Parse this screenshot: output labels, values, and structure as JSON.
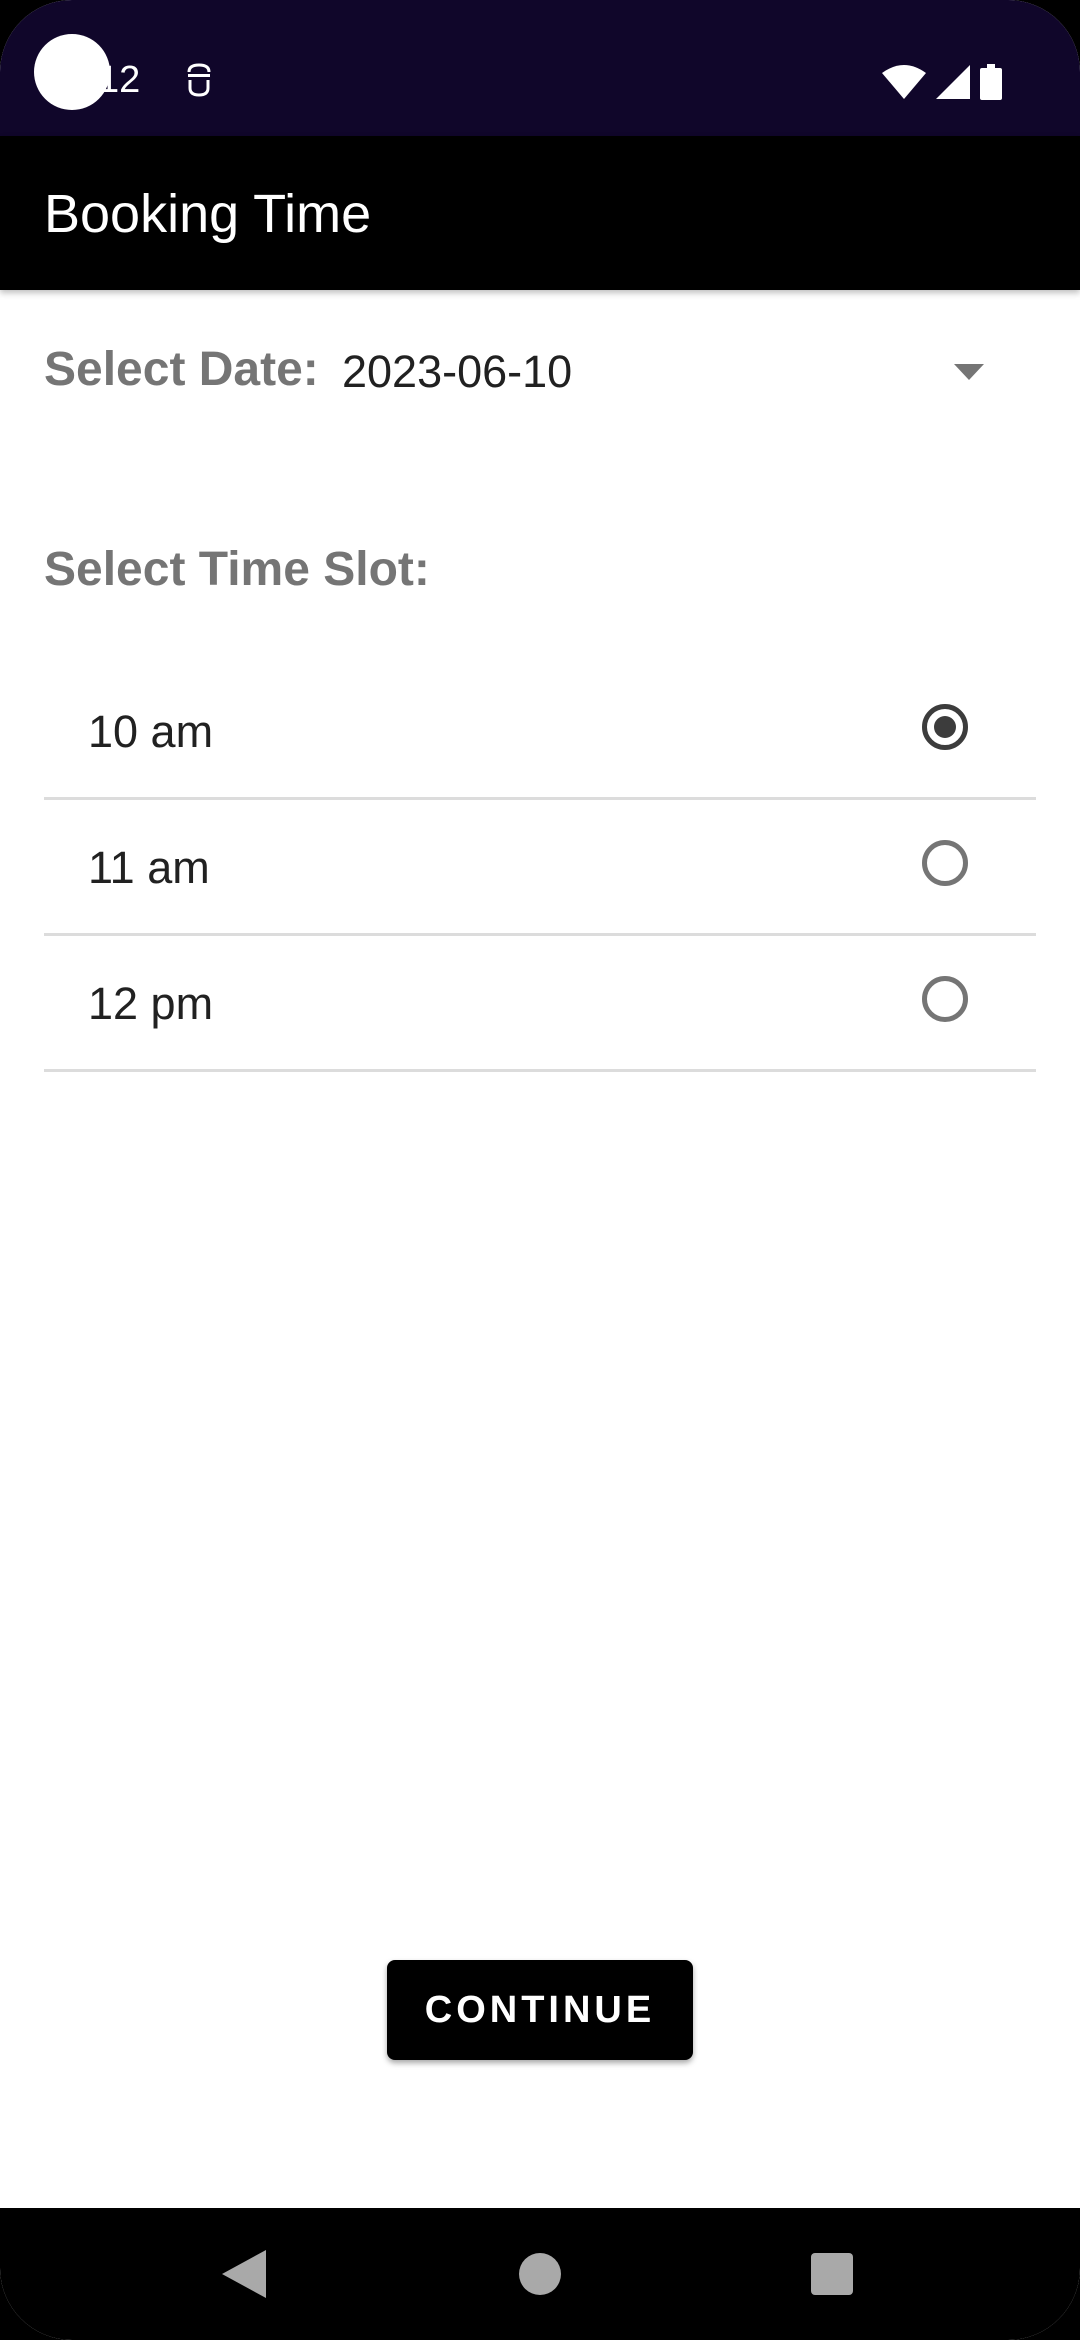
{
  "status_bar": {
    "time": "12",
    "icons": [
      "app-notification-icon",
      "wifi-icon",
      "cell-signal-icon",
      "battery-icon"
    ],
    "background": "#10062a"
  },
  "app_bar": {
    "title": "Booking Time",
    "background": "#000000"
  },
  "date_select": {
    "label": "Select Date:",
    "value": "2023-06-10"
  },
  "time_slots": {
    "label": "Select Time Slot:",
    "options": [
      {
        "label": "10 am",
        "selected": true
      },
      {
        "label": "11 am",
        "selected": false
      },
      {
        "label": "12 pm",
        "selected": false
      }
    ]
  },
  "continue_button": {
    "label": "CONTINUE"
  },
  "nav_bar": {
    "buttons": [
      "back-icon",
      "home-icon",
      "recents-icon"
    ]
  }
}
